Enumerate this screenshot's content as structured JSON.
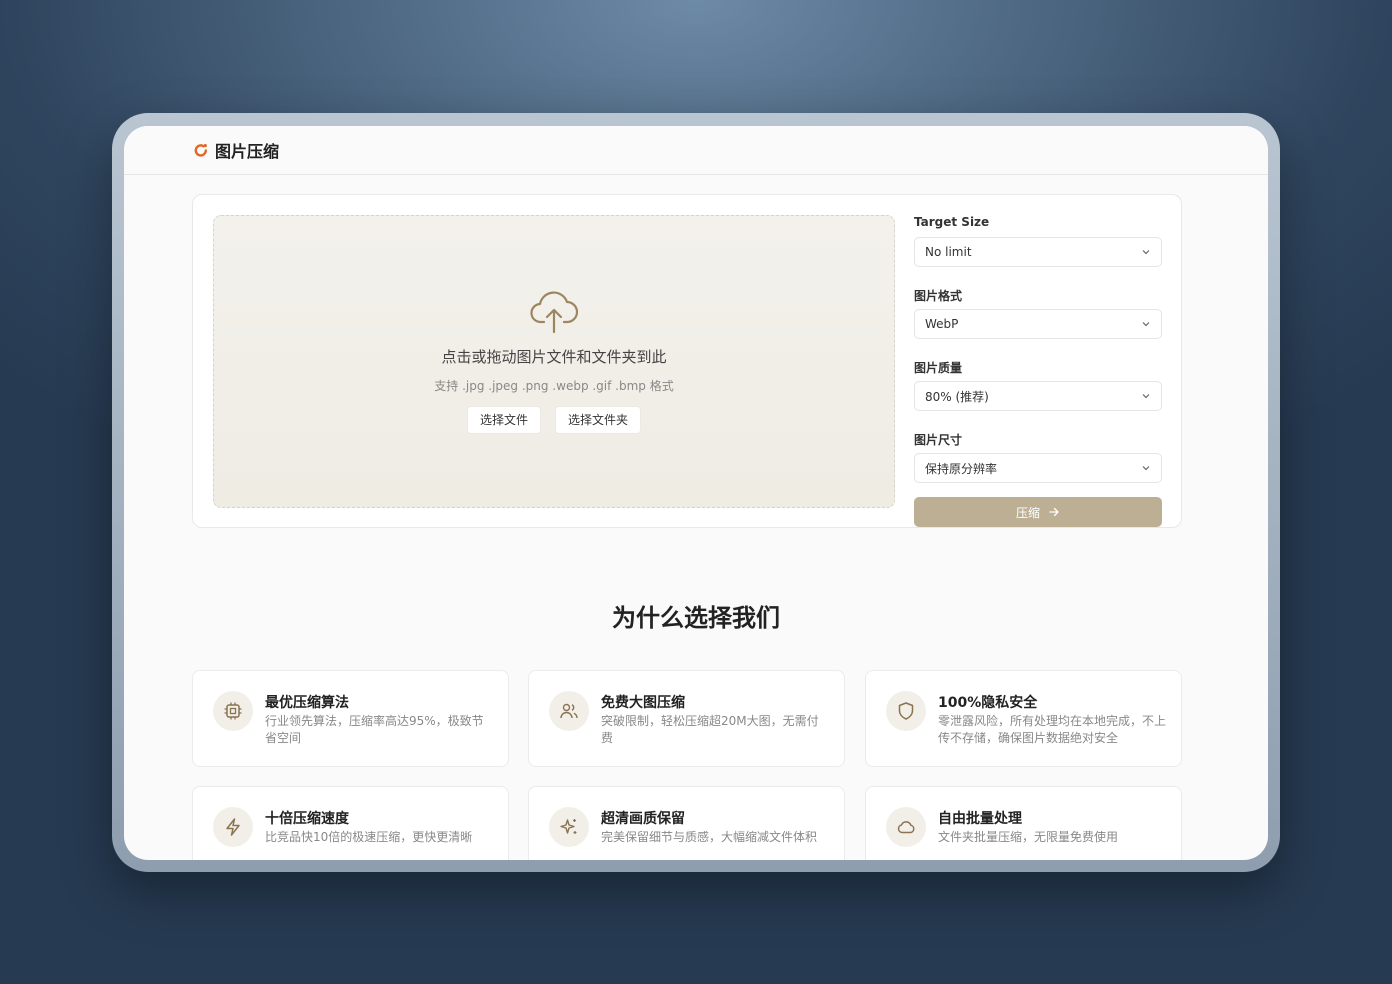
{
  "app": {
    "title": "图片压缩"
  },
  "upload": {
    "title": "点击或拖动图片文件和文件夹到此",
    "subtitle": "支持 .jpg .jpeg .png .webp .gif .bmp 格式",
    "select_file": "选择文件",
    "select_folder": "选择文件夹"
  },
  "settings": {
    "target_size": {
      "label": "Target Size",
      "value": "No limit"
    },
    "format": {
      "label": "图片格式",
      "value": "WebP"
    },
    "quality": {
      "label": "图片质量",
      "value": "80% (推荐)"
    },
    "dimension": {
      "label": "图片尺寸",
      "value": "保持原分辨率"
    },
    "compress_label": "压缩"
  },
  "why": {
    "title": "为什么选择我们",
    "cards": [
      {
        "icon": "cpu-icon",
        "title": "最优压缩算法",
        "desc": "行业领先算法，压缩率高达95%，极致节省空间"
      },
      {
        "icon": "users-icon",
        "title": "免费大图压缩",
        "desc": "突破限制，轻松压缩超20M大图，无需付费"
      },
      {
        "icon": "shield-icon",
        "title": "100%隐私安全",
        "desc": "零泄露风险，所有处理均在本地完成，不上传不存储，确保图片数据绝对安全"
      },
      {
        "icon": "lightning-icon",
        "title": "十倍压缩速度",
        "desc": "比竞品快10倍的极速压缩，更快更清晰"
      },
      {
        "icon": "sparkles-icon",
        "title": "超清画质保留",
        "desc": "完美保留细节与质感，大幅缩减文件体积"
      },
      {
        "icon": "cloud-icon",
        "title": "自由批量处理",
        "desc": "文件夹批量压缩，无限量免费使用"
      }
    ]
  },
  "colors": {
    "accent": "#bcaf94",
    "icon": "#8a7350",
    "logo": "#e2672a"
  }
}
